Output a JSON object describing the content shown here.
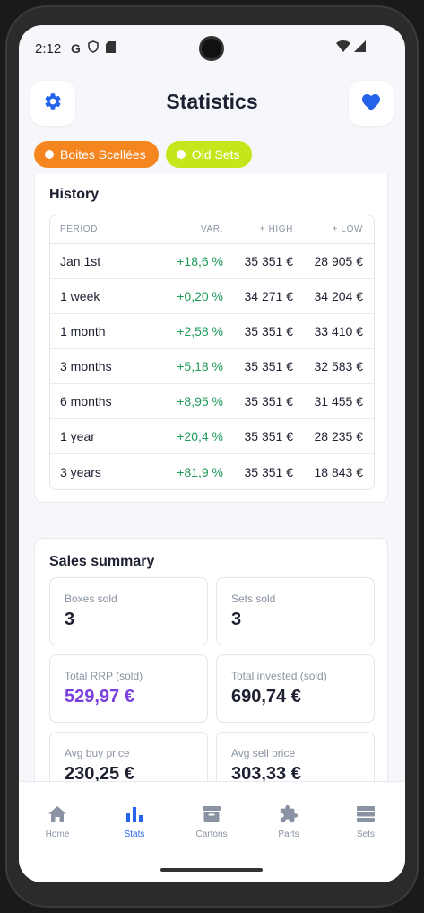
{
  "status_bar": {
    "time": "2:12",
    "left_icons": [
      "google-icon",
      "shield-icon",
      "sd-card-icon"
    ],
    "right_icons": [
      "wifi-icon",
      "signal-icon"
    ]
  },
  "header": {
    "title": "Statistics",
    "left_icon": "gear-icon",
    "right_icon": "heart-icon"
  },
  "filters": [
    {
      "label": "Boites Scellées",
      "color": "#f5851f"
    },
    {
      "label": "Old Sets",
      "color": "#c4e61b"
    }
  ],
  "history": {
    "title": "History",
    "columns": [
      "PERIOD",
      "VAR.",
      "+ HIGH",
      "+ LOW"
    ],
    "rows": [
      {
        "period": "Jan 1st",
        "var": "+18,6 %",
        "high": "35 351 €",
        "low": "28 905 €"
      },
      {
        "period": "1 week",
        "var": "+0,20 %",
        "high": "34 271 €",
        "low": "34 204 €"
      },
      {
        "period": "1 month",
        "var": "+2,58 %",
        "high": "35 351 €",
        "low": "33 410 €"
      },
      {
        "period": "3 months",
        "var": "+5,18 %",
        "high": "35 351 €",
        "low": "32 583 €"
      },
      {
        "period": "6 months",
        "var": "+8,95 %",
        "high": "35 351 €",
        "low": "31 455 €"
      },
      {
        "period": "1 year",
        "var": "+20,4 %",
        "high": "35 351 €",
        "low": "28 235 €"
      },
      {
        "period": "3 years",
        "var": "+81,9 %",
        "high": "35 351 €",
        "low": "18 843 €"
      }
    ]
  },
  "sales_summary": {
    "title": "Sales summary",
    "stats": [
      {
        "label": "Boxes sold",
        "value": "3"
      },
      {
        "label": "Sets sold",
        "value": "3"
      },
      {
        "label": "Total RRP (sold)",
        "value": "529,97 €",
        "accent": "#7b3fe0"
      },
      {
        "label": "Total invested (sold)",
        "value": "690,74 €"
      },
      {
        "label": "Avg buy price",
        "value": "230,25 €"
      },
      {
        "label": "Avg sell price",
        "value": "303,33 €"
      }
    ]
  },
  "nav": {
    "items": [
      {
        "label": "Home",
        "icon": "home-icon"
      },
      {
        "label": "Stats",
        "icon": "bar-chart-icon",
        "active": true
      },
      {
        "label": "Cartons",
        "icon": "archive-box-icon"
      },
      {
        "label": "Parts",
        "icon": "puzzle-piece-icon"
      },
      {
        "label": "Sets",
        "icon": "list-icon"
      }
    ]
  },
  "colors": {
    "primary": "#2563eb",
    "positive": "#1e9a5a",
    "purple": "#7b3fe0"
  }
}
